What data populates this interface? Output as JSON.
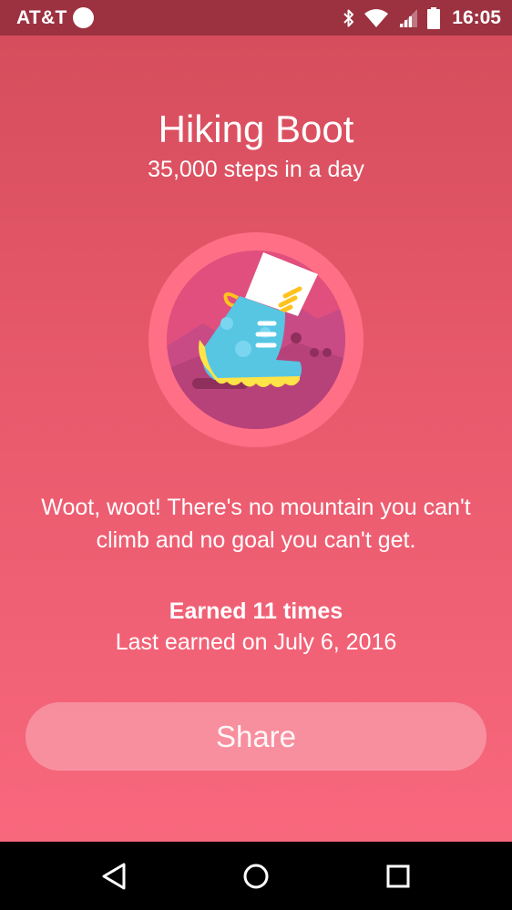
{
  "status_bar": {
    "carrier": "AT&T",
    "time": "16:05",
    "icons": [
      "record-dot-icon",
      "bluetooth-icon",
      "wifi-icon",
      "signal-icon",
      "battery-icon"
    ]
  },
  "badge": {
    "title": "Hiking Boot",
    "subtitle": "35,000 steps in a day",
    "icon": "hiking-boot-icon",
    "message": "Woot, woot! There's no mountain you can't climb and no goal you can't get.",
    "earned_count": "Earned 11 times",
    "last_earned": "Last earned on July 6, 2016"
  },
  "actions": {
    "share_label": "Share"
  },
  "nav_bar": {
    "icons": [
      "back-icon",
      "home-icon",
      "recents-icon"
    ]
  },
  "colors": {
    "background_top": "#d44c5b",
    "background_bottom": "#fb6a80",
    "status_bar": "#9c3140",
    "badge_ring": "#ff6f86",
    "badge_inner": "#c84b86",
    "boot": "#56c6e3",
    "boot_sole": "#ffe347"
  }
}
